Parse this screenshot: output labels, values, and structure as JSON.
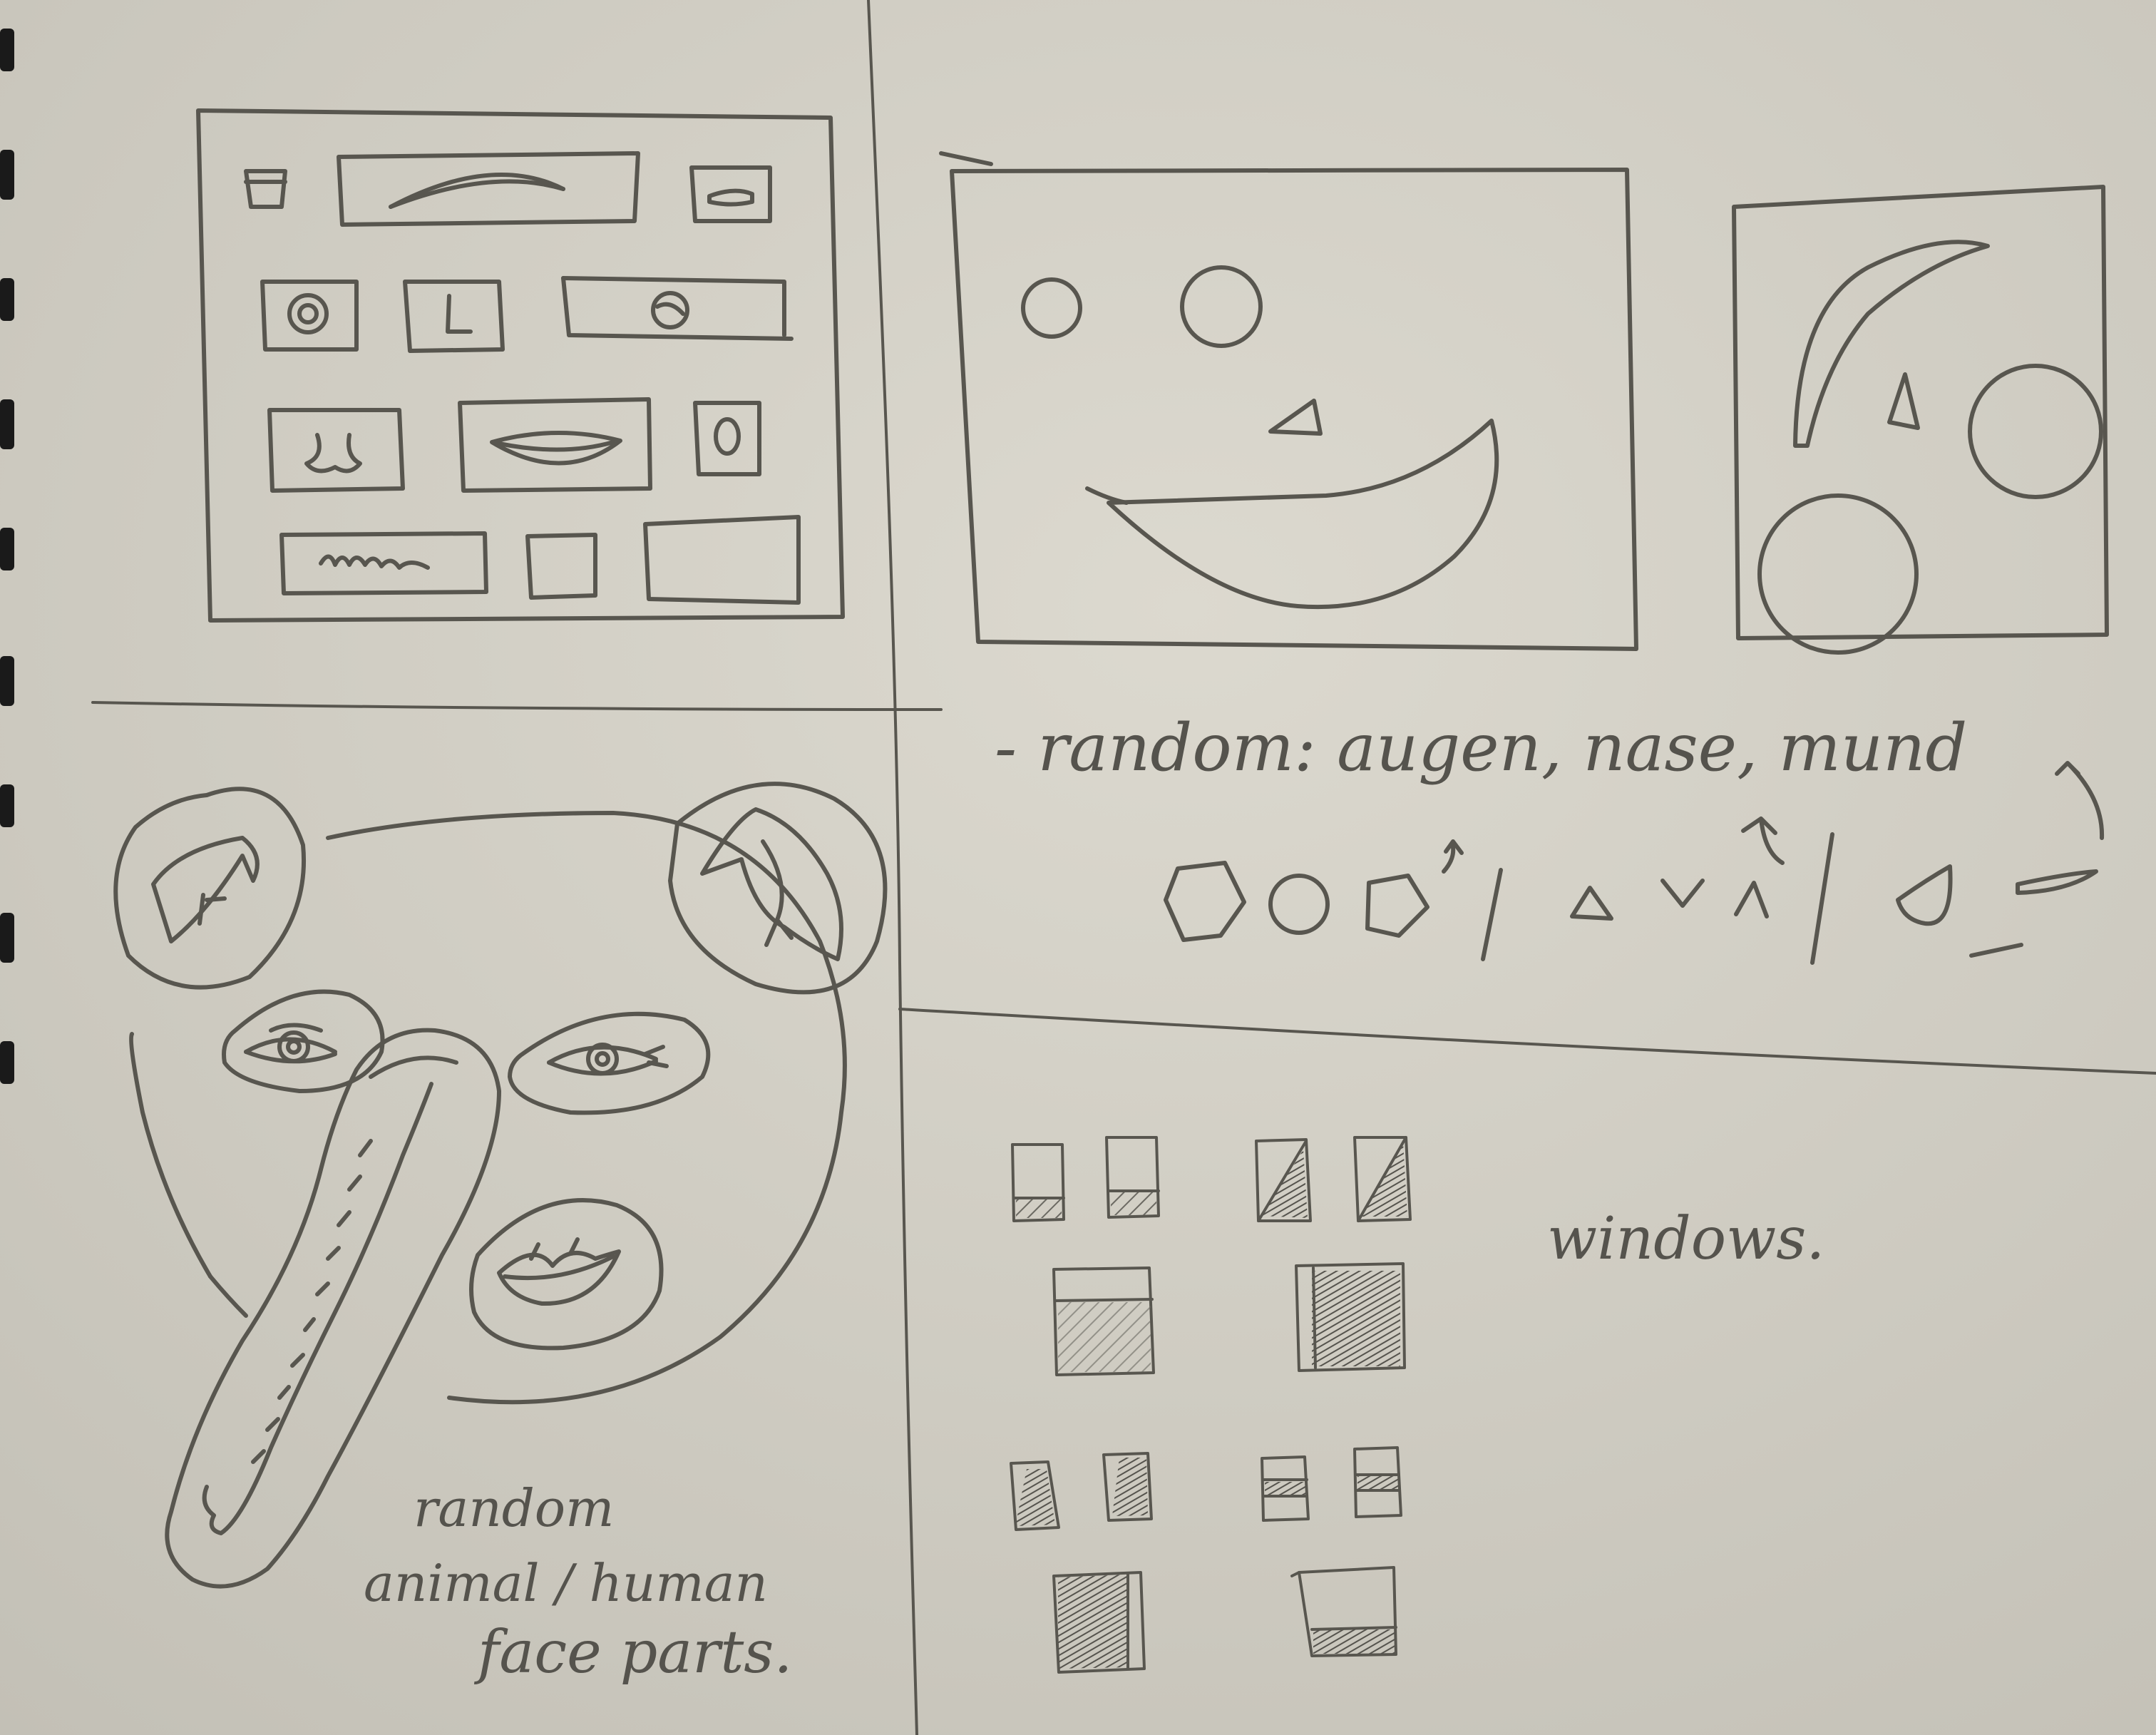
{
  "notes": {
    "random_features": "- random: augen, nase, mund",
    "face_parts_line1": "random",
    "face_parts_line2": "animal / human",
    "face_parts_line3": "face parts.",
    "windows": "windows."
  },
  "colors": {
    "paper": "#d3d0c6",
    "pencil": "#58564f",
    "binding": "#1a1a1a"
  }
}
